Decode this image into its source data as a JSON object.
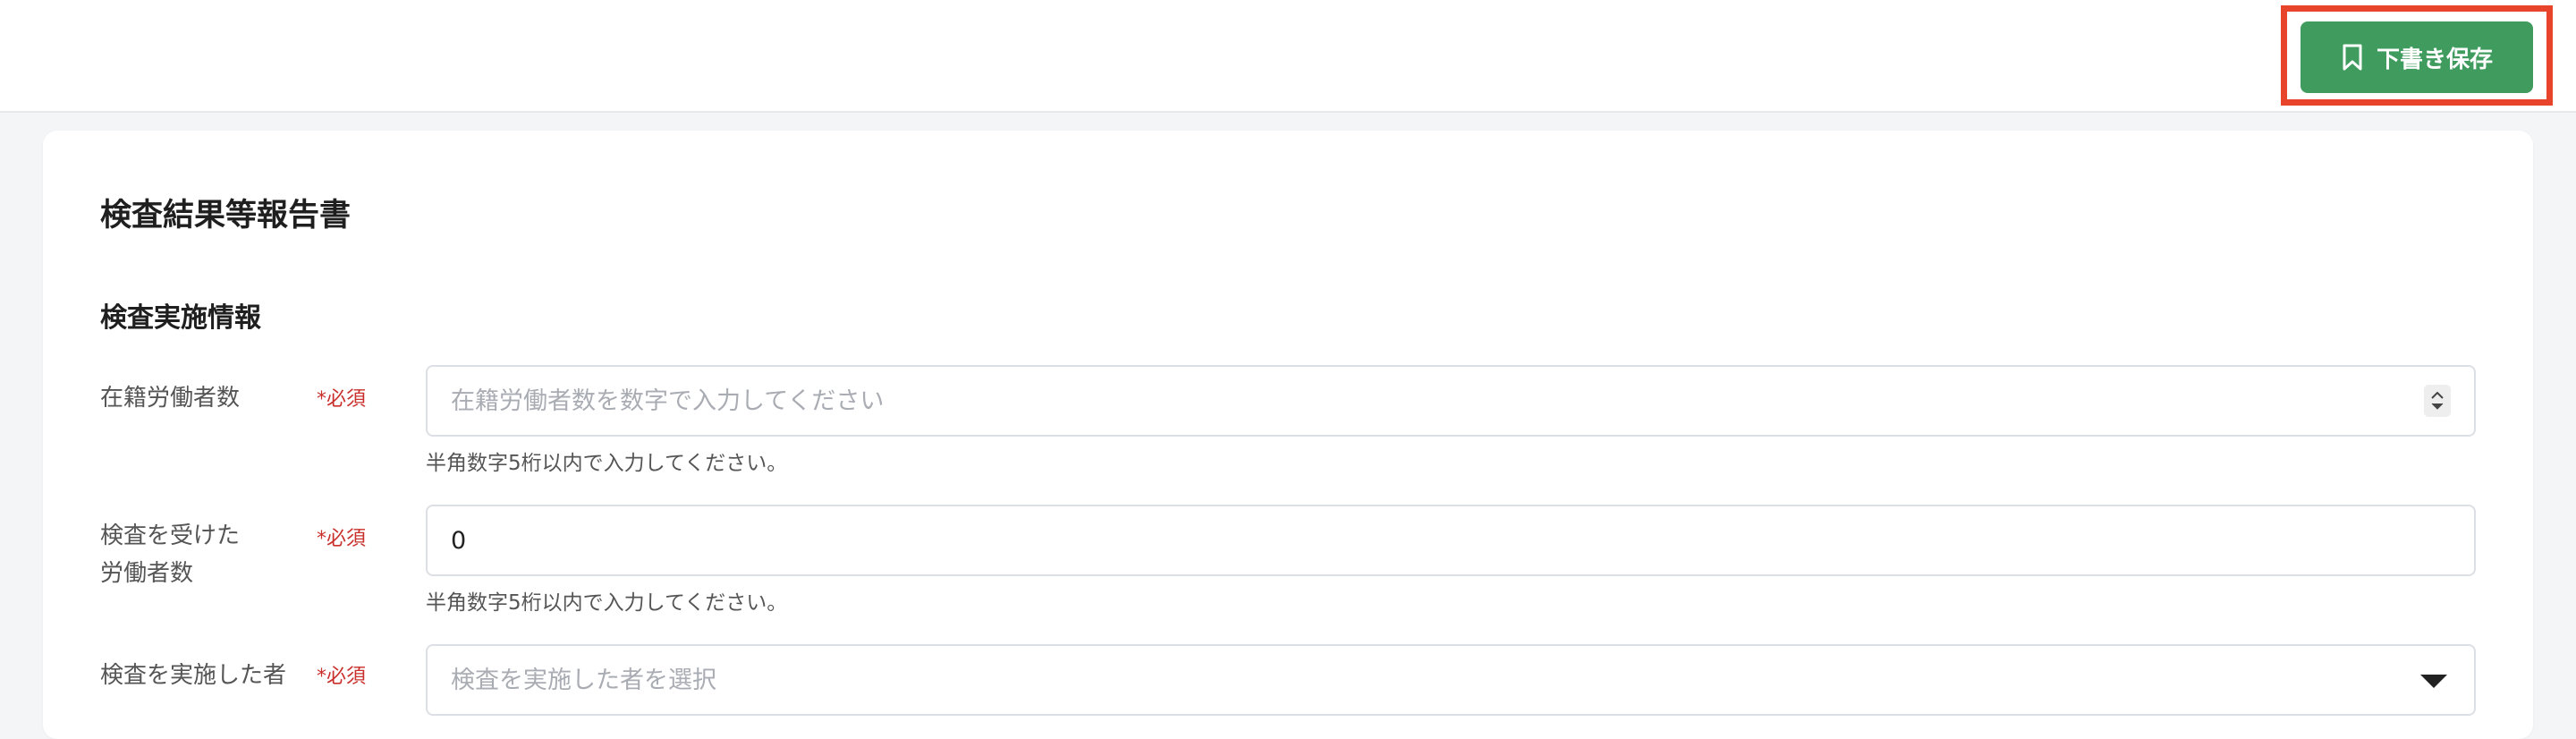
{
  "header": {
    "save_draft_label": "下書き保存"
  },
  "page": {
    "title": "検査結果等報告書"
  },
  "section": {
    "title": "検査実施情報"
  },
  "fields": [
    {
      "label": "在籍労働者数",
      "required": "*必須",
      "placeholder": "在籍労働者数を数字で入力してください",
      "value": "",
      "help": "半角数字5桁以内で入力してください。"
    },
    {
      "label_line1": "検査を受けた",
      "label_line2": "労働者数",
      "required": "*必須",
      "value": "0",
      "help": "半角数字5桁以内で入力してください。"
    },
    {
      "label": "検査を実施した者",
      "required": "*必須",
      "placeholder": "検査を実施した者を選択"
    }
  ],
  "colors": {
    "accent": "#3f9c5e",
    "highlight": "#e8442c",
    "required": "#c9302c"
  },
  "icons": {
    "save": "bookmark-icon",
    "select": "caret-down-icon",
    "stepper": "stepper-icon"
  }
}
